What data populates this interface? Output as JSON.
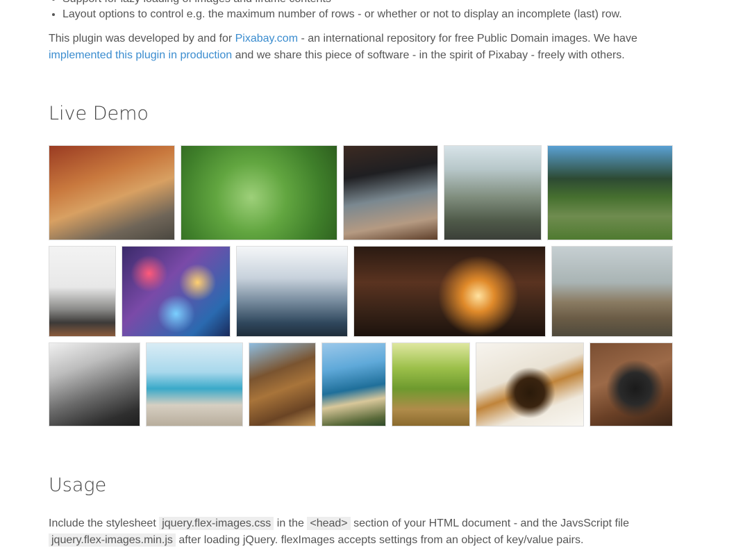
{
  "features": {
    "items": [
      "Support for lazy loading of images and iframe contents",
      "Layout options to control e.g. the maximum number of rows - or whether or not to display an incomplete (last) row."
    ]
  },
  "intro": {
    "part1": "This plugin was developed by and for ",
    "link1": "Pixabay.com",
    "part2": " - an international repository for free Public Domain images. We have ",
    "link2": "implemented this plugin in production",
    "part3": " and we share this piece of software - in the spirit of Pixabay - freely with others."
  },
  "live_demo": {
    "heading": "Live Demo",
    "photos": [
      {
        "name": "photo-alley",
        "bg": "linear-gradient(160deg,#9a3b22 0%,#c9793e 35%,#d8a062 55%,#6f6558 80%,#4a4740 100%)"
      },
      {
        "name": "photo-leaf-drops",
        "bg": "radial-gradient(circle at 45% 55%,#9ed07a 0%,#62a640 35%,#3f7f2a 70%,#2e5f1f 100%)"
      },
      {
        "name": "photo-laptop-phone",
        "bg": "linear-gradient(170deg,#3c2a22 0%,#1f1f22 30%,#7a8890 55%,#b59a82 80%,#5e3f2a 100%)"
      },
      {
        "name": "photo-cliff-road",
        "bg": "linear-gradient(180deg,#d7e3e8 0%,#b7c7c9 25%,#7f8d7d 55%,#4f5a49 80%,#3b3f38 100%)"
      },
      {
        "name": "photo-forest-path",
        "bg": "linear-gradient(180deg,#5aa1d4 0%,#2d4a33 35%,#46702f 55%,#6f8c4f 75%,#4f7a30 100%)"
      },
      {
        "name": "photo-record-player",
        "bg": "linear-gradient(180deg,#f3f3f3 0%,#e8e8e8 45%,#8a8a88 70%,#3c3a38 85%,#8a5b3c 100%)"
      },
      {
        "name": "photo-bokeh-lights",
        "bg": "radial-gradient(circle at 25% 30%,#ff5a7a 0%,transparent 18%),radial-gradient(circle at 70% 40%,#ffd070 0%,transparent 20%),radial-gradient(circle at 50% 75%,#7ad0ff 0%,transparent 22%),linear-gradient(135deg,#3a2a6a 0%,#7a4aa8 40%,#2a6ab0 80%,#1a2a5a 100%)"
      },
      {
        "name": "photo-steaming-cup",
        "bg": "linear-gradient(180deg,#f4f6f8 0%,#c8d2dc 35%,#7a8ea0 60%,#30485e 85%,#1f2d3a 100%)"
      },
      {
        "name": "photo-sunset-street",
        "bg": "radial-gradient(circle at 65% 55%,#ffe2a0 0%,#e08a2a 12%,transparent 30%),linear-gradient(180deg,#2a1a12 0%,#5a3320 40%,#3a2418 70%,#1c120c 100%)"
      },
      {
        "name": "photo-log-pile",
        "bg": "linear-gradient(180deg,#c6cfd2 0%,#a9b4b4 40%,#8a7b62 62%,#6b5c46 80%,#4f4a3c 100%)"
      },
      {
        "name": "photo-mountain-valley",
        "bg": "linear-gradient(160deg,#f0f0f0 0%,#bdbdbd 30%,#6a6a6a 60%,#2f2f2f 85%,#1e1e1e 100%)"
      },
      {
        "name": "photo-pelican-pier",
        "bg": "linear-gradient(180deg,#d9ecf5 0%,#a8d8ec 35%,#3aa9c9 55%,#d6cfc2 75%,#b8ad9c 100%)"
      },
      {
        "name": "photo-iron-arches",
        "bg": "linear-gradient(160deg,#8fbde0 0%,#7a5430 35%,#a8743a 55%,#6a4424 80%,#c79a5a 100%)"
      },
      {
        "name": "photo-coastline",
        "bg": "linear-gradient(170deg,#9cc8ea 0%,#5fa9d9 30%,#1f6f9a 55%,#d8c79a 70%,#5a6a3a 90%,#2f4a2a 100%)"
      },
      {
        "name": "photo-mossy-field",
        "bg": "linear-gradient(180deg,#dfe7a0 0%,#9cc04a 30%,#6e9a2e 55%,#b08c4a 80%,#8a6a2e 100%)"
      },
      {
        "name": "photo-honey-dipper",
        "bg": "radial-gradient(circle at 50% 60%,#2a1a0a 0%,#3a2410 20%,transparent 35%),linear-gradient(160deg,#f7f4ee 0%,#e9e2d4 40%,#c0843a 55%,#efe9dd 75%,#f9f7f2 100%)"
      },
      {
        "name": "photo-camera-hands",
        "bg": "radial-gradient(circle at 55% 55%,#1a1a1a 0%,#2a2a2a 25%,transparent 45%),linear-gradient(160deg,#7a4e32 0%,#9c6a48 40%,#6a4026 70%,#3a2416 100%)"
      }
    ]
  },
  "usage": {
    "heading": "Usage",
    "t1": "Include the stylesheet ",
    "c1": "jquery.flex-images.css",
    "t2": " in the ",
    "c2": "<head>",
    "t3": " section of your HTML document - and the JavsScript file ",
    "c3": "jquery.flex-images.min.js",
    "t4": " after loading jQuery. flexImages accepts settings from an object of key/value pairs."
  }
}
